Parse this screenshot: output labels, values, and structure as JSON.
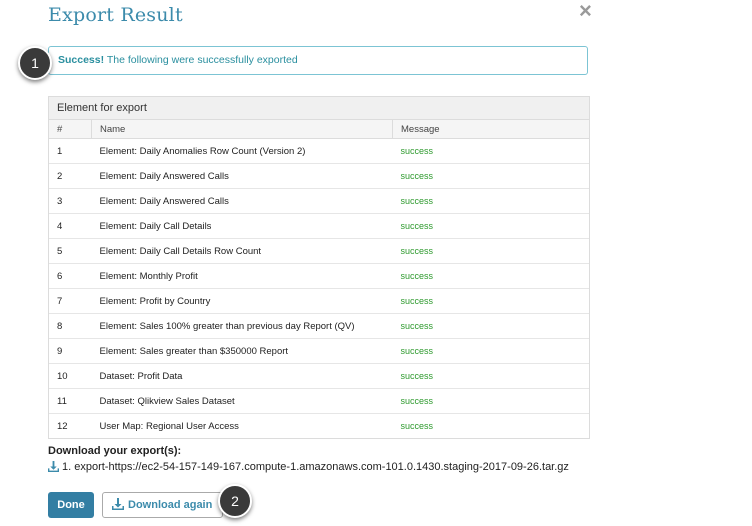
{
  "dialog": {
    "title": "Export Result",
    "close_glyph": "×"
  },
  "alert": {
    "strong": "Success!",
    "text": " The following were successfully exported"
  },
  "callouts": [
    "1",
    "2"
  ],
  "table": {
    "caption": "Element for export",
    "headers": [
      "#",
      "Name",
      "Message"
    ],
    "rows": [
      {
        "num": "1",
        "name": "Element: Daily Anomalies Row Count (Version 2)",
        "message": "success"
      },
      {
        "num": "2",
        "name": "Element: Daily Answered Calls",
        "message": "success"
      },
      {
        "num": "3",
        "name": "Element: Daily Answered Calls",
        "message": "success"
      },
      {
        "num": "4",
        "name": "Element: Daily Call Details",
        "message": "success"
      },
      {
        "num": "5",
        "name": "Element: Daily Call Details Row Count",
        "message": "success"
      },
      {
        "num": "6",
        "name": "Element: Monthly Profit",
        "message": "success"
      },
      {
        "num": "7",
        "name": "Element: Profit by Country",
        "message": "success"
      },
      {
        "num": "8",
        "name": "Element: Sales 100% greater than previous day Report (QV)",
        "message": "success"
      },
      {
        "num": "9",
        "name": "Element: Sales greater than $350000 Report",
        "message": "success"
      },
      {
        "num": "10",
        "name": "Dataset: Profit Data",
        "message": "success"
      },
      {
        "num": "11",
        "name": "Dataset: Qlikview Sales Dataset",
        "message": "success"
      },
      {
        "num": "12",
        "name": "User Map: Regional User Access",
        "message": "success"
      }
    ]
  },
  "downloads": {
    "heading": "Download your export(s):",
    "links": [
      "1. export-https://ec2-54-157-149-167.compute-1.amazonaws.com-101.0.1430.staging-2017-09-26.tar.gz"
    ]
  },
  "buttons": {
    "done": "Done",
    "download_again": "Download again"
  },
  "colors": {
    "accent": "#3c8bab",
    "success_text": "#2e9a2e",
    "primary_button": "#337ea3"
  },
  "icons": {
    "close": "close-icon",
    "download": "download-icon"
  }
}
